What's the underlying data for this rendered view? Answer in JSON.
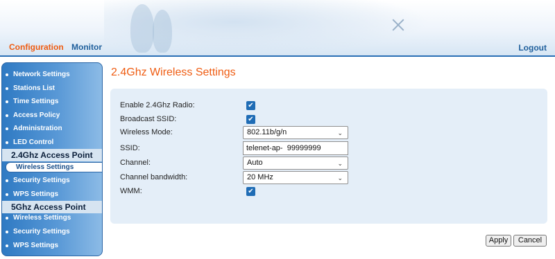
{
  "header": {
    "tabs": [
      {
        "label": "Configuration",
        "active": true,
        "color": "#ef5c12"
      },
      {
        "label": "Monitor",
        "active": false,
        "color": "#1f5f9c"
      }
    ],
    "logout_label": "Logout"
  },
  "sidebar": {
    "items": [
      {
        "label": "Network Settings"
      },
      {
        "label": "Stations List"
      },
      {
        "label": "Time Settings"
      },
      {
        "label": "Access Policy"
      },
      {
        "label": "Administration"
      },
      {
        "label": "LED Control"
      }
    ],
    "section_24": {
      "title": "2.4Ghz Access Point",
      "items": [
        {
          "label": "Wireless Settings",
          "active": true
        },
        {
          "label": "Security Settings"
        },
        {
          "label": "WPS Settings"
        }
      ]
    },
    "section_5": {
      "title": "5Ghz Access Point",
      "items": [
        {
          "label": "Wireless Settings"
        },
        {
          "label": "Security Settings"
        },
        {
          "label": "WPS Settings"
        }
      ]
    }
  },
  "main": {
    "title": "2.4Ghz Wireless Settings",
    "form": {
      "enable_radio": {
        "label": "Enable 2.4Ghz Radio:",
        "checked": true
      },
      "broadcast_ssid": {
        "label": "Broadcast SSID:",
        "checked": true
      },
      "wireless_mode": {
        "label": "Wireless Mode:",
        "value": "802.11b/g/n"
      },
      "ssid": {
        "label": "SSID:",
        "value": "telenet-ap-  99999999"
      },
      "channel": {
        "label": "Channel:",
        "value": "Auto"
      },
      "channel_bandwidth": {
        "label": "Channel bandwidth:",
        "value": "20 MHz"
      },
      "wmm": {
        "label": "WMM:",
        "checked": true
      }
    },
    "buttons": {
      "apply": "Apply",
      "cancel": "Cancel"
    }
  },
  "icons": {
    "checkbox_checked": "check-icon",
    "dropdown": "chevron-down-icon",
    "bullet": "bullet-icon"
  }
}
